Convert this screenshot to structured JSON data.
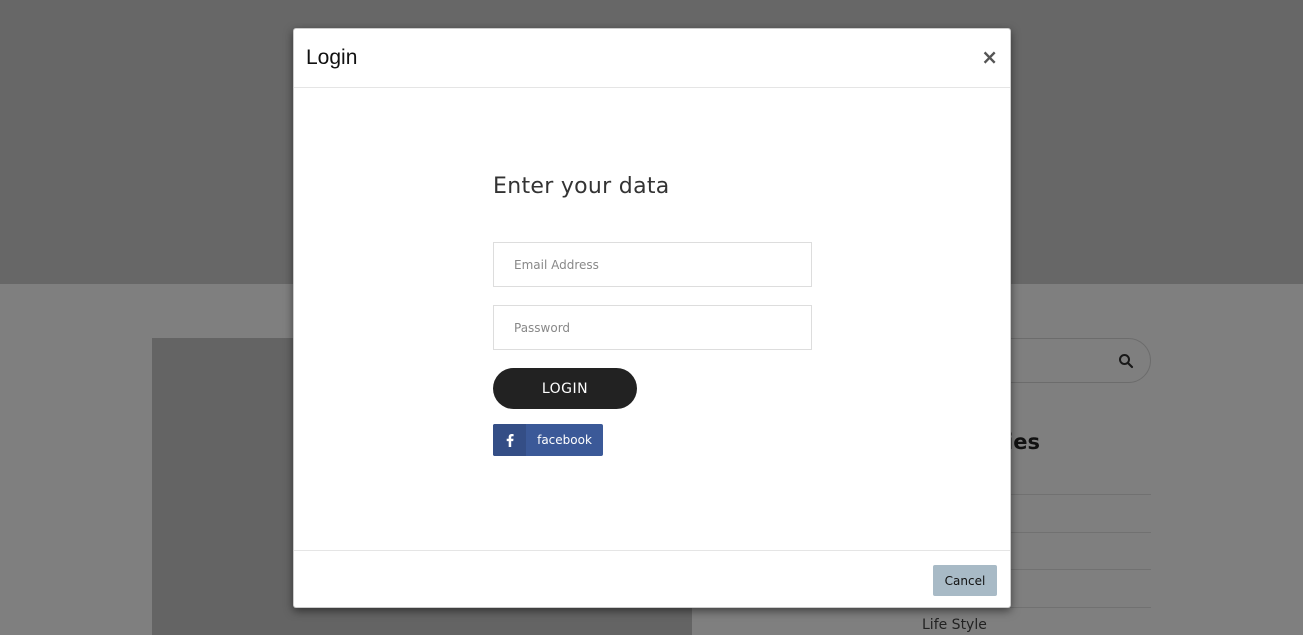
{
  "background": {
    "heading_partial": "ies",
    "category_item": "Life Style"
  },
  "modal": {
    "title": "Login",
    "close_label": "×",
    "heading": "Enter your data",
    "email": {
      "placeholder": "Email Address",
      "value": ""
    },
    "password": {
      "placeholder": "Password",
      "value": ""
    },
    "login_label": "LOGIN",
    "facebook_label": "facebook",
    "cancel_label": "Cancel"
  },
  "colors": {
    "login_button": "#222222",
    "facebook": "#3b5998",
    "cancel_button": "#a8bac6"
  },
  "icons": {
    "search": "search-icon",
    "facebook": "facebook-icon",
    "close": "close-icon"
  }
}
